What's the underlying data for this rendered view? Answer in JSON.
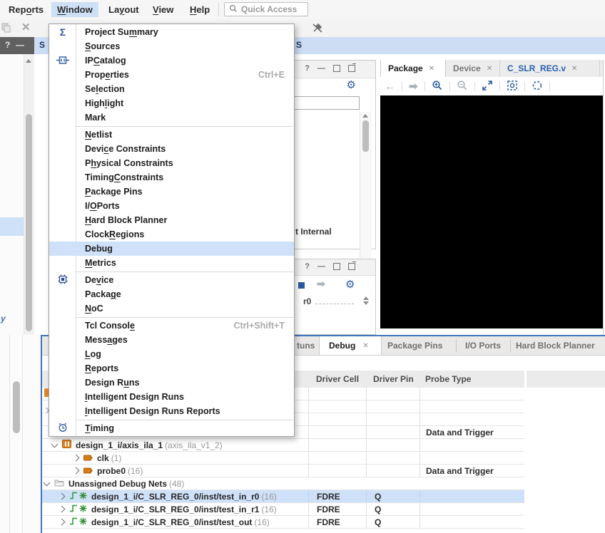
{
  "glyphs": {
    "close": "✕",
    "help": "?",
    "minimize": "—",
    "gear": "⚙",
    "sigma": "Σ",
    "left_arrow": "←",
    "right_arrow": "➡"
  },
  "menubar": {
    "items": [
      {
        "pre": "Rep",
        "u": "o",
        "post": "rts"
      },
      {
        "pre": "",
        "u": "W",
        "post": "indow"
      },
      {
        "pre": "La",
        "u": "y",
        "post": "out"
      },
      {
        "pre": "",
        "u": "V",
        "post": "iew"
      },
      {
        "pre": "",
        "u": "H",
        "post": "elp"
      }
    ],
    "quick_access_placeholder": "Quick Access"
  },
  "window_menu": {
    "items": [
      {
        "pre": "Project Su",
        "u": "m",
        "post": "mary",
        "icon": "sigma-icon"
      },
      {
        "pre": "",
        "u": "S",
        "post": "ources"
      },
      {
        "pre": "IP ",
        "u": "C",
        "post": "atalog",
        "icon": "ip-catalog-icon"
      },
      {
        "pre": "Prop",
        "u": "e",
        "post": "rties",
        "shortcut": "Ctrl+E"
      },
      {
        "pre": "Se",
        "u": "l",
        "post": "ection"
      },
      {
        "pre": "High",
        "u": "l",
        "post": "ight"
      },
      {
        "pre": "Mark",
        "u": "",
        "post": ""
      },
      {
        "pre": "",
        "u": "N",
        "post": "etlist"
      },
      {
        "pre": "Devi",
        "u": "c",
        "post": "e Constraints"
      },
      {
        "pre": "P",
        "u": "h",
        "post": "ysical Constraints"
      },
      {
        "pre": "Timing ",
        "u": "C",
        "post": "onstraints"
      },
      {
        "pre": "",
        "u": "P",
        "post": "ackage Pins"
      },
      {
        "pre": "I/",
        "u": "O",
        "post": " Ports"
      },
      {
        "pre": "",
        "u": "H",
        "post": "ard Block Planner"
      },
      {
        "pre": "Clock ",
        "u": "R",
        "post": "egions"
      },
      {
        "pre": "Debug",
        "u": "",
        "post": "",
        "icon": "bug-icon",
        "highlighted": true
      },
      {
        "pre": "",
        "u": "M",
        "post": "etrics"
      },
      {
        "pre": "De",
        "u": "v",
        "post": "ice",
        "icon": "chip-icon"
      },
      {
        "pre": "Packa",
        "u": "g",
        "post": "e"
      },
      {
        "pre": "",
        "u": "N",
        "post": "oC"
      },
      {
        "pre": "Tcl Consol",
        "u": "e",
        "post": "",
        "shortcut": "Ctrl+Shift+T"
      },
      {
        "pre": "Mess",
        "u": "a",
        "post": "ges"
      },
      {
        "pre": "",
        "u": "L",
        "post": "og"
      },
      {
        "pre": "",
        "u": "R",
        "post": "eports"
      },
      {
        "pre": "Design R",
        "u": "u",
        "post": "ns"
      },
      {
        "pre": "",
        "u": "I",
        "post": "ntelligent Design Runs"
      },
      {
        "pre": "",
        "u": "I",
        "post": "ntelligent Design Runs Reports"
      },
      {
        "pre": "",
        "u": "T",
        "post": "iming",
        "icon": "clock-icon"
      }
    ]
  },
  "banner": {
    "left_fragment": "S",
    "right_fragment": "S"
  },
  "left_strip": {
    "clipped_text": "y"
  },
  "middle": {
    "panel1": {
      "partial_text": "t Internal"
    },
    "panel2": {
      "value_fragment": "r0"
    }
  },
  "right_panel": {
    "tabs": [
      {
        "label": "Package",
        "active": true
      },
      {
        "label": "Device",
        "active": false
      },
      {
        "label": "C_SLR_REG.v",
        "active": false
      }
    ]
  },
  "bottom": {
    "tabs": {
      "fragment": "tuns",
      "debug": "Debug",
      "others": [
        "Package Pins",
        "I/O Ports",
        "Hard Block Planner"
      ]
    },
    "columns": [
      "Driver Cell",
      "Driver Pin",
      "Probe Type"
    ],
    "rows": [
      {},
      {},
      {},
      {
        "probe_type": "Data and Trigger"
      },
      {
        "name": "design_1_i/axis_ila_1",
        "suffix": "(axis_ila_v1_2)"
      },
      {
        "name": "clk",
        "suffix": "(1)"
      },
      {
        "name": "probe0",
        "suffix": "(16)",
        "probe_type": "Data and Trigger"
      },
      {
        "name": "Unassigned Debug Nets",
        "suffix": "(48)"
      },
      {
        "name": "design_1_i/C_SLR_REG_0/inst/test_in_r0",
        "suffix": "(16)",
        "driver_cell": "FDRE",
        "driver_pin": "Q",
        "selected": true
      },
      {
        "name": "design_1_i/C_SLR_REG_0/inst/test_in_r1",
        "suffix": "(16)",
        "driver_cell": "FDRE",
        "driver_pin": "Q"
      },
      {
        "name": "design_1_i/C_SLR_REG_0/inst/test_out",
        "suffix": "(16)",
        "driver_cell": "FDRE",
        "driver_pin": "Q"
      }
    ]
  },
  "colors": {
    "accent": "#2a5b9e",
    "selection": "#cfe1f8",
    "banner": "#cdddf4",
    "focus_border": "#3f72c1"
  }
}
